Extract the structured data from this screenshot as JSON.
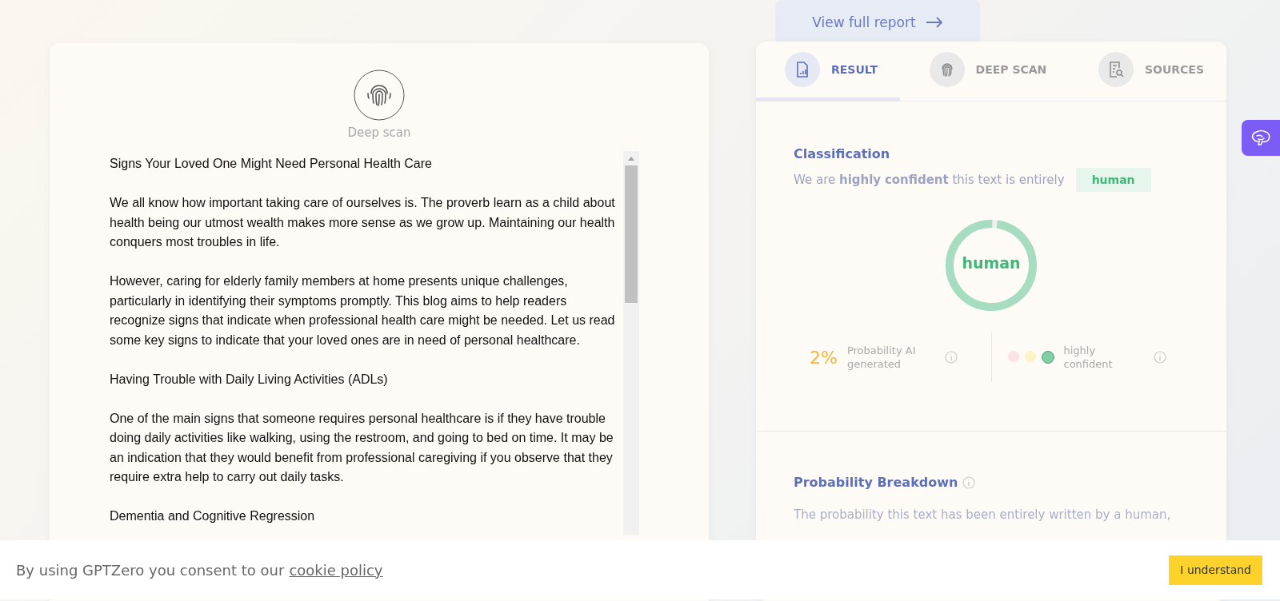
{
  "document_panel": {
    "scan_label": "Deep scan",
    "paragraphs": [
      "Signs Your Loved One Might Need Personal Health Care",
      "We all know how important taking care of ourselves is. The proverb learn as a child about health being our utmost wealth makes more sense as we grow up. Maintaining our health conquers most troubles in life.",
      "However, caring for elderly family members at home presents unique challenges, particularly in identifying their symptoms promptly. This blog aims to help readers recognize signs that indicate when professional health care might be needed. Let us read some key signs to indicate that your loved ones are in need of personal healthcare.",
      "Having Trouble with Daily Living Activities (ADLs)",
      "One of the main signs that someone requires personal healthcare is if they have trouble doing daily activities like walking, using the restroom, and going to bed on time. It may be an indication that they would benefit from professional caregiving if you observe that they require extra help to carry out daily tasks.",
      "Dementia and Cognitive Regression"
    ]
  },
  "report_link": "View full report",
  "tabs": [
    {
      "label": "RESULT",
      "kind": "result",
      "selected": true
    },
    {
      "label": "DEEP SCAN",
      "kind": "fingerprint",
      "selected": false
    },
    {
      "label": "SOURCES",
      "kind": "sources",
      "selected": false
    }
  ],
  "classification": {
    "title": "Classification",
    "sentence": "We are **highly** **confident** this text is entirely",
    "verdict": "human",
    "donut": {
      "label": "human",
      "level": 0.98
    },
    "ai_probability": {
      "value": "2%",
      "label": "Probability AI generated"
    },
    "confidence": {
      "dots": [
        {
          "color": "#fde2e4",
          "selected": false
        },
        {
          "color": "#fdf3c8",
          "selected": false
        },
        {
          "color": "#7fd0a5",
          "selected": true
        }
      ],
      "label": "highly confident"
    }
  },
  "breakdown": {
    "title": "Probability Breakdown",
    "text": "The probability this text has been entirely written by a human,"
  },
  "cookie_bar": {
    "text": "By using GPTZero you consent to our",
    "link": "cookie policy",
    "button": "I understand"
  }
}
